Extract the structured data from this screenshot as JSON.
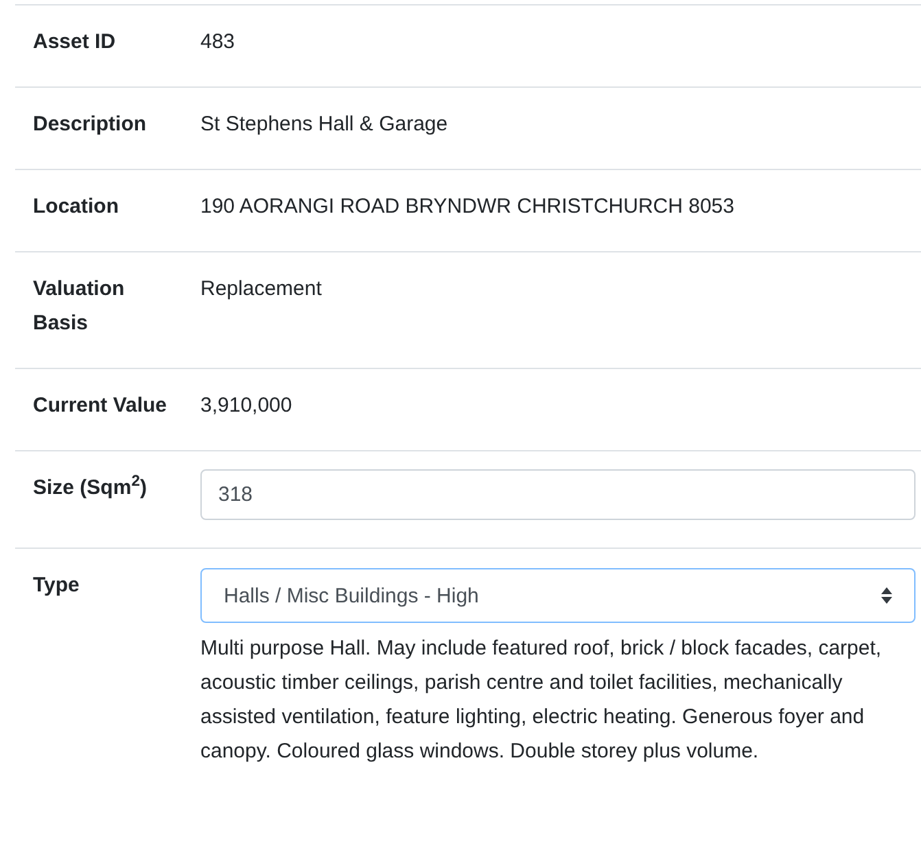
{
  "rows": [
    {
      "kind": "text",
      "label": "Asset ID",
      "value": "483"
    },
    {
      "kind": "text",
      "label": "Description",
      "value": "St Stephens Hall & Garage"
    },
    {
      "kind": "text",
      "label": "Location",
      "value": "190 AORANGI ROAD BRYNDWR CHRISTCHURCH 8053"
    },
    {
      "kind": "text",
      "label": "Valuation Basis",
      "value": "Replacement"
    },
    {
      "kind": "text",
      "label": "Current Value",
      "value": "3,910,000"
    },
    {
      "kind": "input",
      "label": "Size (Sqm$^{2}$)",
      "value": "318"
    },
    {
      "kind": "select",
      "label": "Type",
      "value": "Halls / Misc Buildings - High",
      "focused": true,
      "help": "Multi purpose Hall. May include featured roof, brick / block facades, carpet, acoustic timber ceilings, parish centre and toilet facilities, mechanically assisted ventilation, feature lighting, electric heating. Generous foyer and canopy. Coloured glass windows. Double storey plus volume."
    }
  ]
}
